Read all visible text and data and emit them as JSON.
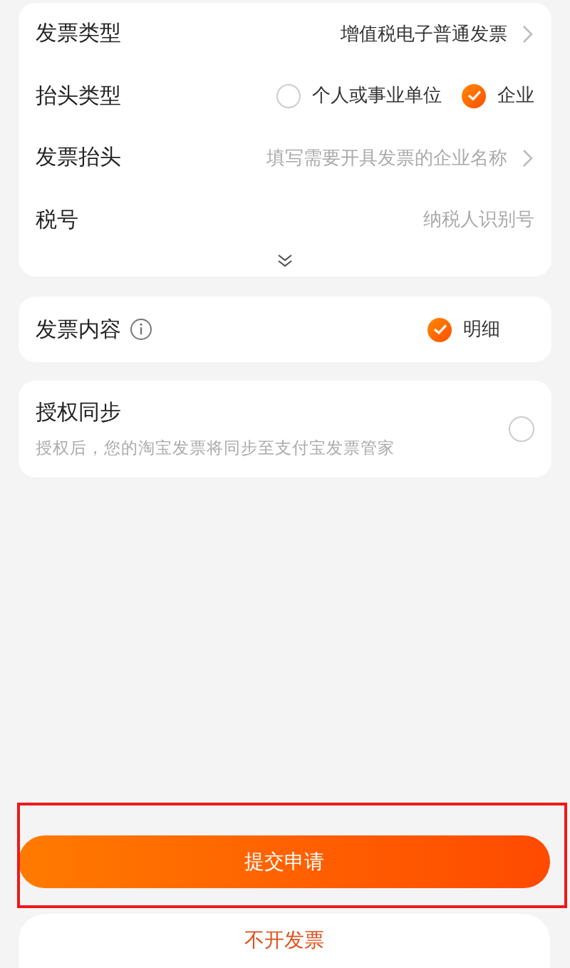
{
  "invoice_card": {
    "rows": [
      {
        "kind": "select",
        "label": "发票类型",
        "value": "增值税电子普通发票"
      },
      {
        "kind": "radio",
        "label": "抬头类型",
        "options": [
          {
            "label": "个人或事业单位",
            "selected": false
          },
          {
            "label": "企业",
            "selected": true
          }
        ]
      },
      {
        "kind": "select",
        "label": "发票抬头",
        "placeholder": "填写需要开具发票的企业名称"
      },
      {
        "kind": "input",
        "label": "税号",
        "placeholder": "纳税人识别号"
      }
    ],
    "expanded": false
  },
  "content_card": {
    "label": "发票内容",
    "options": [
      {
        "label": "明细",
        "selected": true
      }
    ]
  },
  "sync_card": {
    "title": "授权同步",
    "description": "授权后，您的淘宝发票将同步至支付宝发票管家",
    "checked": false
  },
  "submit_button": {
    "label": "提交申请",
    "highlighted": true
  },
  "cancel_button": {
    "label": "不开发票"
  }
}
